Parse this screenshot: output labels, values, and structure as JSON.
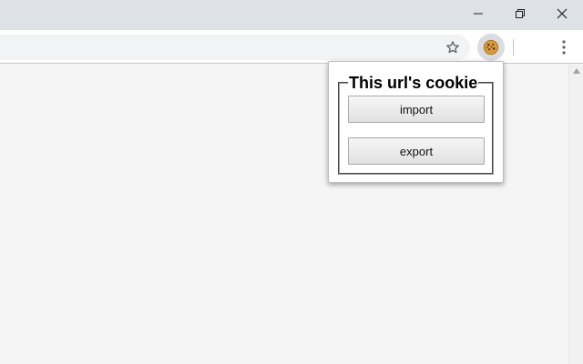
{
  "browser": {
    "window_controls": {
      "minimize_icon": "minimize-icon",
      "restore_icon": "restore-icon",
      "close_icon": "close-icon"
    },
    "toolbar": {
      "bookmark_icon": "star-icon",
      "extension_icon": "cookie-icon",
      "menu_icon": "kebab-menu-icon"
    }
  },
  "popup": {
    "legend": "This url's cookie",
    "import_label": "import",
    "export_label": "export"
  },
  "colors": {
    "titlebar": "#dee1e6",
    "toolbar": "#ffffff",
    "omnibox": "#f1f3f4",
    "page_background": "#f5f5f5"
  }
}
